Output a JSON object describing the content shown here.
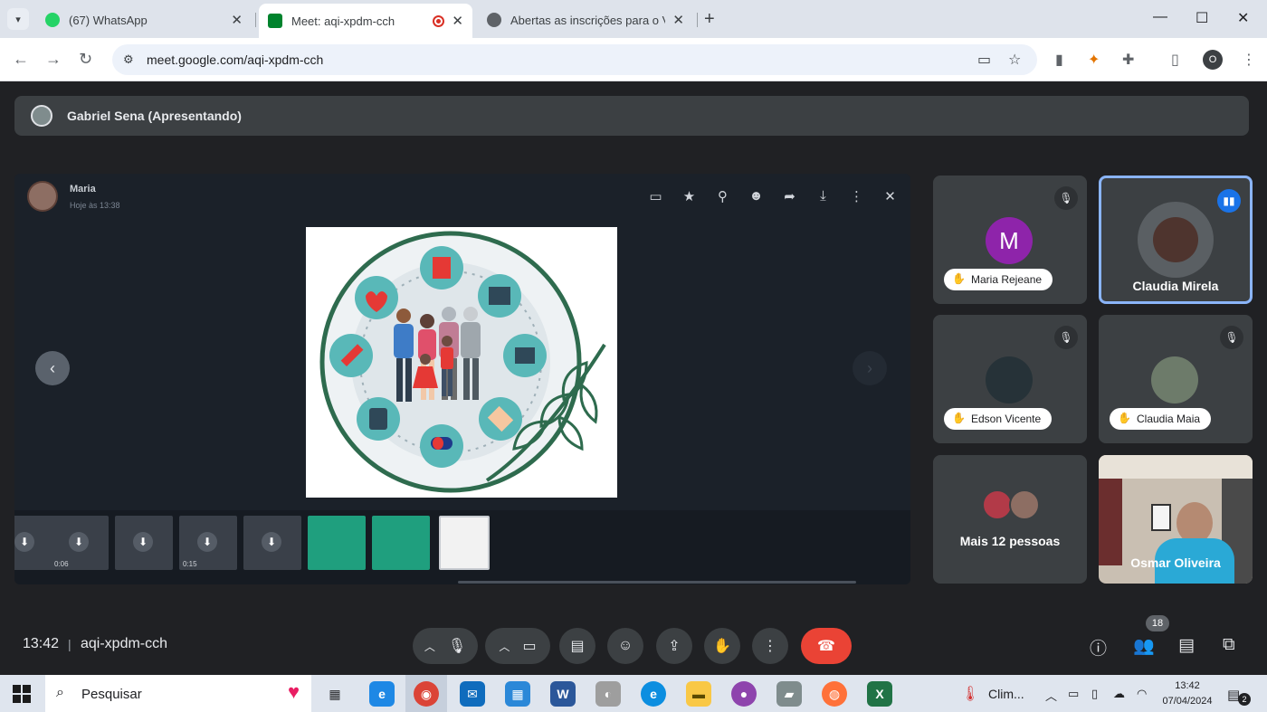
{
  "browser": {
    "tabs": [
      {
        "title": "(67) WhatsApp",
        "color": "#25d366"
      },
      {
        "title": "Meet: aqi-xpdm-cch",
        "color": "#00832d"
      },
      {
        "title": "Abertas as inscrições para o V C",
        "color": "#5f6368"
      }
    ],
    "url": "meet.google.com/aqi-xpdm-cch",
    "profile_initial": "O"
  },
  "meet": {
    "presenter": "Gabriel Sena (Apresentando)",
    "viewer": {
      "sender": "Maria",
      "time": "Hoje às 13:38"
    },
    "thumbnails": [
      {
        "duration": ""
      },
      {
        "duration": "0:06"
      },
      {
        "duration": ""
      },
      {
        "duration": "0:15"
      },
      {
        "duration": ""
      }
    ],
    "participants": [
      {
        "name": "Maria Rejeane",
        "initial": "M",
        "avatar_color": "#8e24aa"
      },
      {
        "name": "Claudia Mirela"
      },
      {
        "name": "Edson Vicente"
      },
      {
        "name": "Claudia Maia"
      },
      {
        "name": "Mais 12 pessoas"
      },
      {
        "name": "Osmar Oliveira"
      }
    ],
    "clock": "13:42",
    "meeting_code": "aqi-xpdm-cch",
    "people_count": "18",
    "end_color": "#ea4335"
  },
  "taskbar": {
    "search_placeholder": "Pesquisar",
    "weather": "Clim...",
    "time": "13:42",
    "date": "07/04/2024",
    "notifications": "2"
  }
}
